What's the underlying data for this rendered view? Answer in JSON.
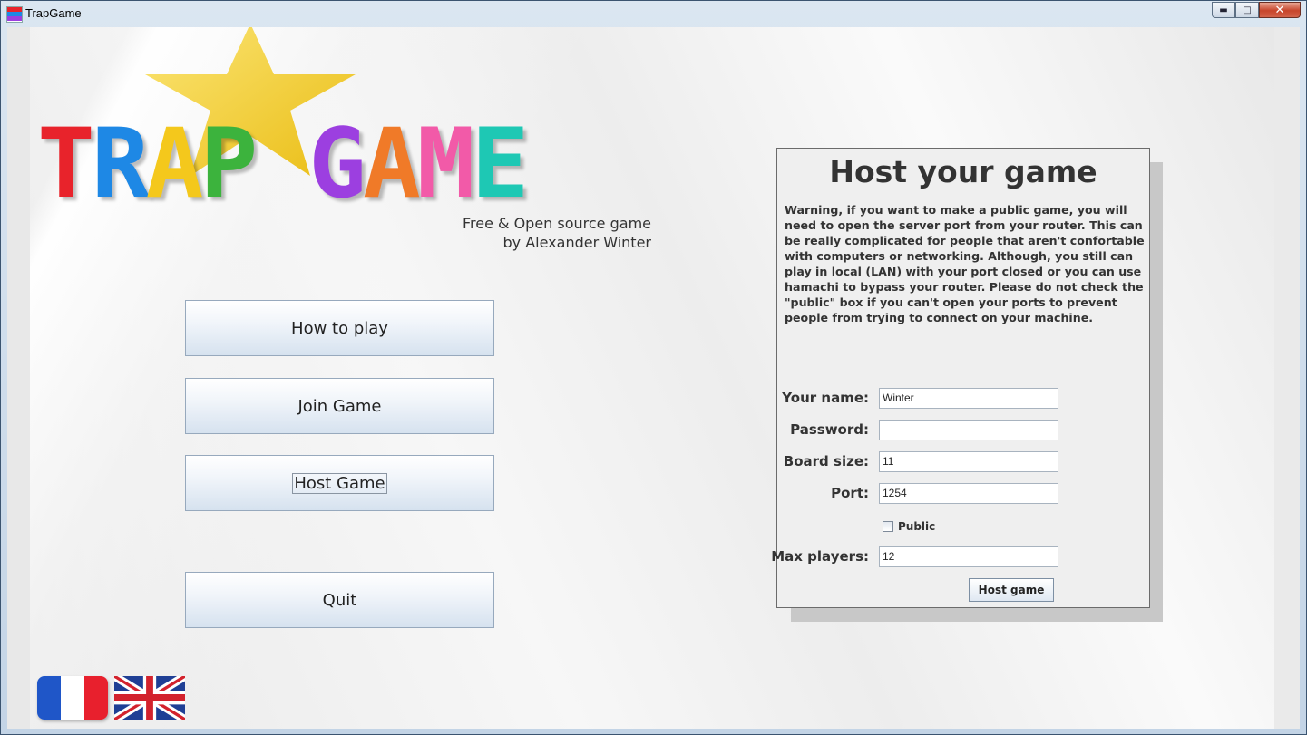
{
  "window": {
    "title": "TrapGame",
    "controls": [
      "minimize",
      "maximize",
      "close"
    ]
  },
  "logo": {
    "letters": [
      {
        "char": "T",
        "color": "#e8232b"
      },
      {
        "char": "R",
        "color": "#1e88e5"
      },
      {
        "char": "A",
        "color": "#f4c81c"
      },
      {
        "char": "P",
        "color": "#3cb33d"
      },
      {
        "char": " ",
        "color": "#000000"
      },
      {
        "char": "G",
        "color": "#9c3fe0"
      },
      {
        "char": "A",
        "color": "#f07a28"
      },
      {
        "char": "M",
        "color": "#f25aa8"
      },
      {
        "char": "E",
        "color": "#1ec8b4"
      }
    ],
    "star_color": "#f5d020"
  },
  "credits": {
    "line1": "Free & Open source game",
    "line2": "by Alexander Winter"
  },
  "menu": {
    "how_to_play": "How to play",
    "join_game": "Join Game",
    "host_game": "Host Game",
    "quit": "Quit"
  },
  "flags": [
    "french-flag",
    "uk-flag"
  ],
  "host_panel": {
    "title": "Host your game",
    "warning": "Warning, if you want to make a public game, you will need to open the server port from your router. This can be really complicated for people that aren't confortable with computers or networking. Although, you still can play in local (LAN) with your port closed or you can use hamachi to bypass your router. Please do not check the \"public\" box if you can't open your ports to prevent people from trying to connect on your machine.",
    "fields": {
      "name_label": "Your name:",
      "name_value": "Winter",
      "password_label": "Password:",
      "password_value": "",
      "board_size_label": "Board size:",
      "board_size_value": "11",
      "port_label": "Port:",
      "port_value": "1254",
      "public_label": "Public",
      "public_checked": false,
      "max_players_label": "Max players:",
      "max_players_value": "12"
    },
    "host_button": "Host game"
  }
}
